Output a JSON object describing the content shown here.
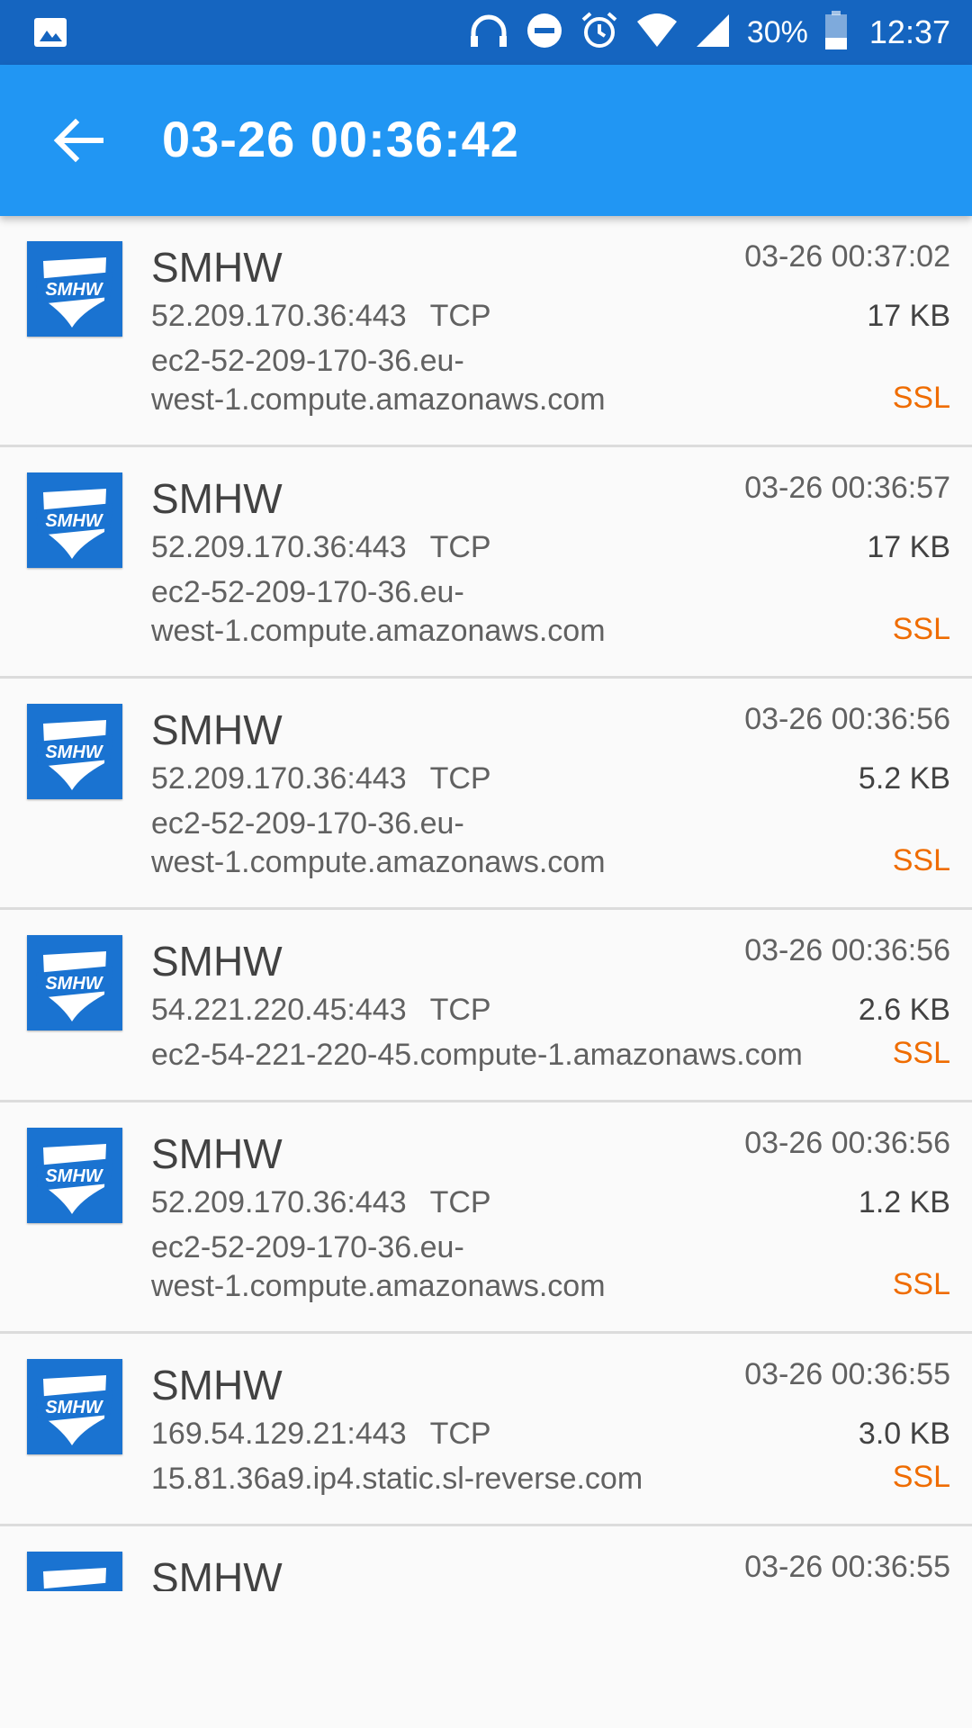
{
  "status_bar": {
    "battery_text": "30%",
    "time": "12:37",
    "icons": [
      "image-icon",
      "headphones-icon",
      "dnd-icon",
      "alarm-icon",
      "wifi-icon",
      "cell-signal-icon",
      "battery-icon"
    ]
  },
  "app_bar": {
    "title": "03-26 00:36:42",
    "back_icon": "arrow-left-icon"
  },
  "colors": {
    "status_bar": "#1565c0",
    "app_bar": "#2196f3",
    "ssl": "#ef6c00",
    "app_icon": "#1a73d1"
  },
  "connections": [
    {
      "app": "SMHW",
      "time": "03-26 00:37:02",
      "address": "52.209.170.36:443",
      "protocol": "TCP",
      "size": "17 KB",
      "host_line1": "ec2-52-209-170-36.eu-",
      "host_line2": "west-1.compute.amazonaws.com",
      "tag": "SSL"
    },
    {
      "app": "SMHW",
      "time": "03-26 00:36:57",
      "address": "52.209.170.36:443",
      "protocol": "TCP",
      "size": "17 KB",
      "host_line1": "ec2-52-209-170-36.eu-",
      "host_line2": "west-1.compute.amazonaws.com",
      "tag": "SSL"
    },
    {
      "app": "SMHW",
      "time": "03-26 00:36:56",
      "address": "52.209.170.36:443",
      "protocol": "TCP",
      "size": "5.2 KB",
      "host_line1": "ec2-52-209-170-36.eu-",
      "host_line2": "west-1.compute.amazonaws.com",
      "tag": "SSL"
    },
    {
      "app": "SMHW",
      "time": "03-26 00:36:56",
      "address": "54.221.220.45:443",
      "protocol": "TCP",
      "size": "2.6 KB",
      "host_line1": "ec2-54-221-220-45.compute-1.amazonaws.com",
      "host_line2": "",
      "tag": "SSL"
    },
    {
      "app": "SMHW",
      "time": "03-26 00:36:56",
      "address": "52.209.170.36:443",
      "protocol": "TCP",
      "size": "1.2 KB",
      "host_line1": "ec2-52-209-170-36.eu-",
      "host_line2": "west-1.compute.amazonaws.com",
      "tag": "SSL"
    },
    {
      "app": "SMHW",
      "time": "03-26 00:36:55",
      "address": "169.54.129.21:443",
      "protocol": "TCP",
      "size": "3.0 KB",
      "host_line1": "15.81.36a9.ip4.static.sl-reverse.com",
      "host_line2": "",
      "tag": "SSL"
    },
    {
      "app": "SMHW",
      "time": "03-26 00:36:55"
    }
  ],
  "app_icon_text": "SMHW"
}
